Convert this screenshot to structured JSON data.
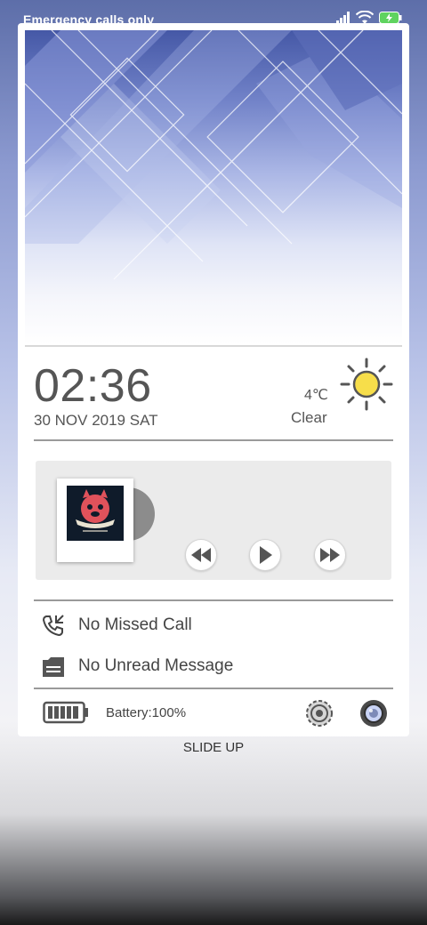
{
  "status_bar": {
    "carrier": "Emergency calls only",
    "icons": [
      "signal-icon",
      "wifi-icon",
      "battery-charging-icon"
    ]
  },
  "clock": {
    "time": "02:36",
    "date": "30 NOV 2019 SAT"
  },
  "weather": {
    "temperature": "4℃",
    "condition": "Clear",
    "icon": "sun-icon"
  },
  "music": {
    "album_art": "album-cover-icon",
    "controls": [
      "rewind-icon",
      "play-icon",
      "fast-forward-icon"
    ]
  },
  "notifications": {
    "missed_call": "No Missed Call",
    "unread_message": "No Unread Message"
  },
  "battery": {
    "label": "Battery:100%",
    "level": 1.0
  },
  "footer": {
    "hint": "SLIDE UP"
  },
  "colors": {
    "sun": "#f7de4a",
    "text": "#555555",
    "panel": "#ebebeb"
  }
}
